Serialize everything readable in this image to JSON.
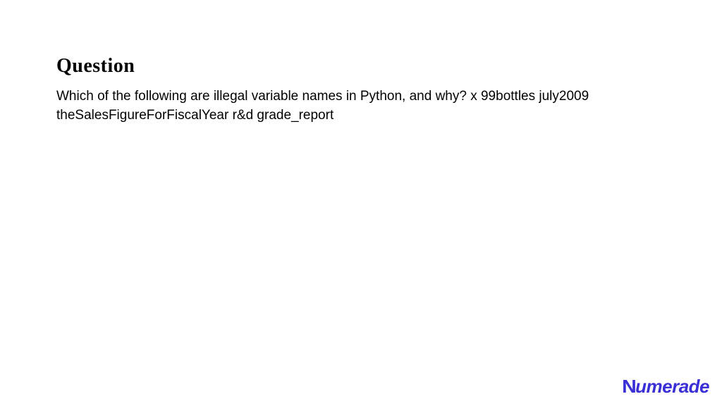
{
  "heading": "Question",
  "body": "Which of the following are illegal variable names in Python, and why? x 99bottles july2009 theSalesFigureForFiscalYear r&d grade_report",
  "brand": "Numerade"
}
